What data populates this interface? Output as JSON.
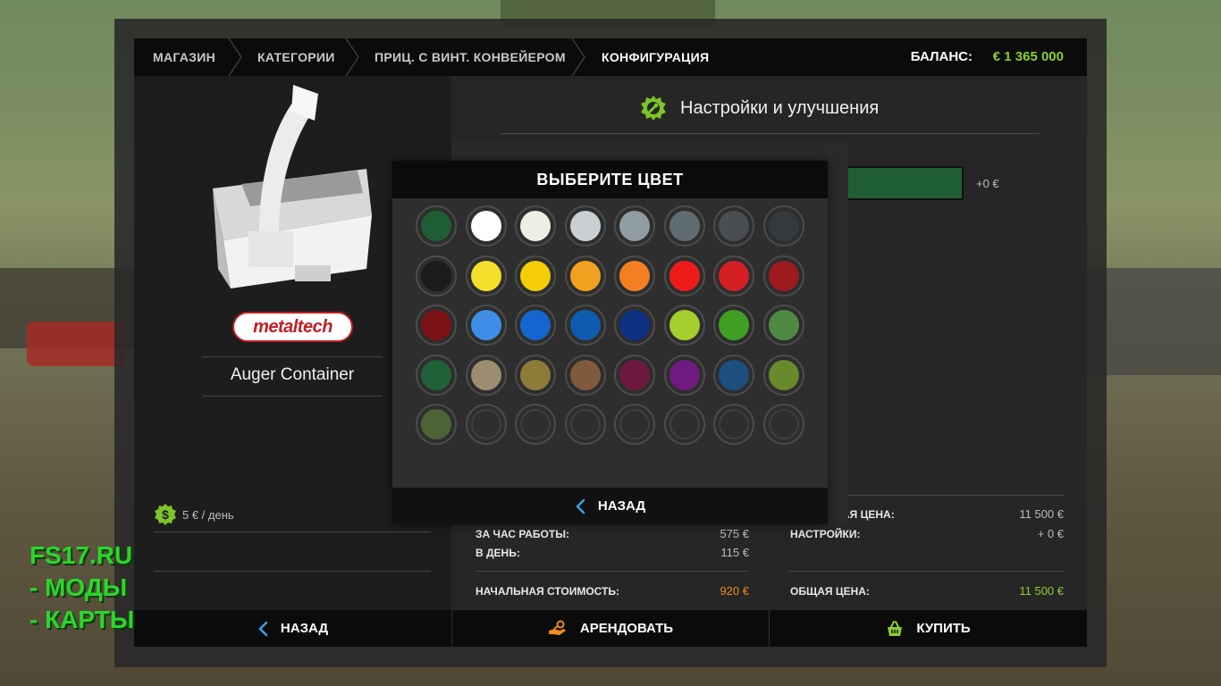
{
  "breadcrumb": {
    "items": [
      "МАГАЗИН",
      "КАТЕГОРИИ",
      "ПРИЦ. С ВИНТ. КОНВЕЙЕРОМ",
      "КОНФИГУРАЦИЯ"
    ],
    "balance_label": "БАЛАНС:",
    "balance_value": "€ 1 365 000"
  },
  "vehicle": {
    "brand": "metaltech",
    "name": "Auger Container",
    "daily_cost": "5 € / день",
    "icon": "dollar-coin-icon"
  },
  "settings": {
    "title": "Настройки и улучшения",
    "icon": "gear-wrench-icon",
    "option_price": "+0 €"
  },
  "stats_left": {
    "per_hour_label": "ЗА ЧАС РАБОТЫ:",
    "per_hour_value": "575 €",
    "per_day_label": "В ДЕНЬ:",
    "per_day_value": "115 €",
    "initial_label": "НАЧАЛЬНАЯ СТОИМОСТЬ:",
    "initial_value": "920 €"
  },
  "stats_right": {
    "base_label": "АЯ ЦЕНА:",
    "base_value": "11 500 €",
    "config_label": "НАСТРОЙКИ:",
    "config_value": "+ 0 €",
    "total_label": "ОБЩАЯ ЦЕНА:",
    "total_value": "11 500 €"
  },
  "bottom": {
    "back_label": "НАЗАД",
    "rent_label": "АРЕНДОВАТЬ",
    "buy_label": "КУПИТЬ"
  },
  "color_dialog": {
    "title": "ВЫБЕРИТЕ ЦВЕТ",
    "back_label": "НАЗАД",
    "colors": [
      "#1f5e34",
      "#ffffff",
      "#eeeee2",
      "#c9cfd2",
      "#8f9da3",
      "#5f6c72",
      "#4a4e52",
      "#34393b",
      "#1c1c1c",
      "#f4e02a",
      "#f4cd06",
      "#f2a01f",
      "#f47f22",
      "#ee1b1b",
      "#d41f24",
      "#9d1a1d",
      "#7b1216",
      "#3e8ee6",
      "#1565d0",
      "#0f5cae",
      "#0e3184",
      "#a4d02e",
      "#40a024",
      "#4f8a45",
      "#216137",
      "#9d8d70",
      "#8d7b3a",
      "#805a3c",
      "#6f1940",
      "#6e1a7e",
      "#1d4f7e",
      "#688a2b",
      "#4d6336",
      "",
      "",
      "",
      "",
      "",
      "",
      ""
    ]
  },
  "watermark": {
    "line1": "FS17.RU",
    "line2": "- МОДЫ",
    "line3": "- КАРТЫ"
  }
}
